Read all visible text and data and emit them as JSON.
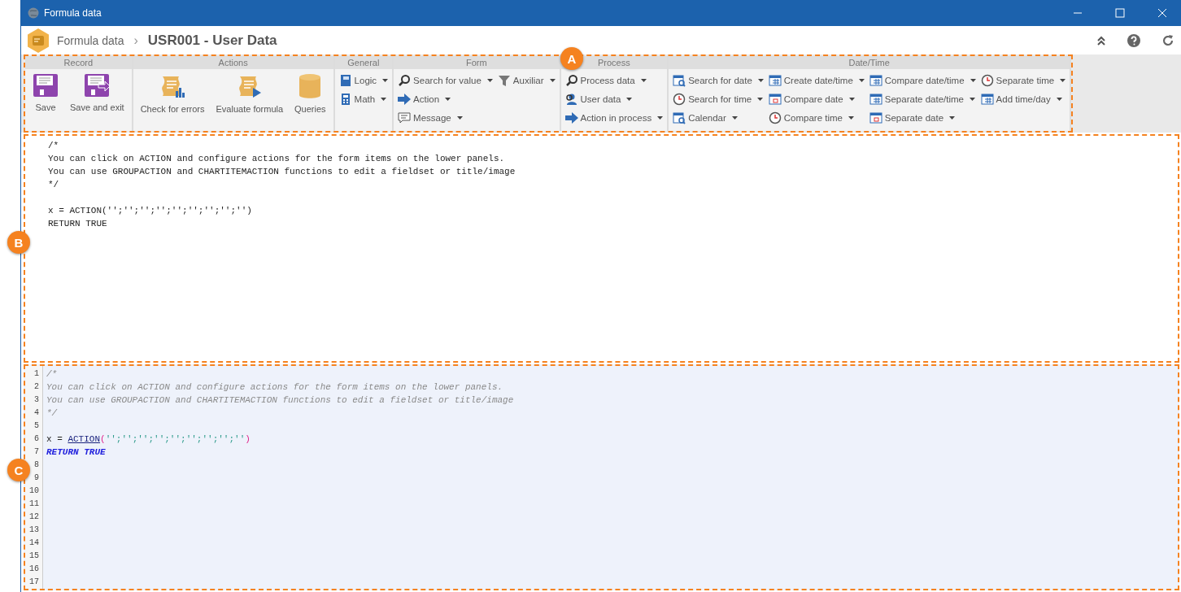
{
  "window": {
    "title": "Formula data"
  },
  "breadcrumb": {
    "parent": "Formula data",
    "separator": "›",
    "current": "USR001 - User Data"
  },
  "ribbon": {
    "badge": "A",
    "groups": [
      {
        "label": "Record",
        "columns": [
          [
            {
              "kind": "large",
              "label": "Save"
            }
          ],
          [
            {
              "kind": "large",
              "label": "Save and exit"
            }
          ]
        ]
      },
      {
        "label": "Actions",
        "columns": [
          [
            {
              "kind": "large",
              "label": "Check for errors"
            }
          ],
          [
            {
              "kind": "large",
              "label": "Evaluate formula"
            }
          ],
          [
            {
              "kind": "large",
              "label": "Queries"
            }
          ]
        ]
      },
      {
        "label": "General",
        "columns": [
          [
            {
              "kind": "small",
              "label": "Logic"
            },
            {
              "kind": "small",
              "label": "Math"
            }
          ]
        ]
      },
      {
        "label": "Form",
        "columns": [
          [
            {
              "kind": "small",
              "label": "Search for value"
            },
            {
              "kind": "small",
              "label": "Action"
            },
            {
              "kind": "small",
              "label": "Message"
            }
          ],
          [
            {
              "kind": "small",
              "label": "Auxiliar"
            }
          ]
        ]
      },
      {
        "label": "Process",
        "columns": [
          [
            {
              "kind": "small",
              "label": "Process data"
            },
            {
              "kind": "small",
              "label": "User data"
            },
            {
              "kind": "small",
              "label": "Action in process"
            }
          ]
        ]
      },
      {
        "label": "Date/Time",
        "columns": [
          [
            {
              "kind": "small",
              "label": "Search for date"
            },
            {
              "kind": "small",
              "label": "Search for time"
            },
            {
              "kind": "small",
              "label": "Calendar"
            }
          ],
          [
            {
              "kind": "small",
              "label": "Create date/time"
            },
            {
              "kind": "small",
              "label": "Compare date"
            },
            {
              "kind": "small",
              "label": "Compare time"
            }
          ],
          [
            {
              "kind": "small",
              "label": "Compare date/time"
            },
            {
              "kind": "small",
              "label": "Separate date/time"
            },
            {
              "kind": "small",
              "label": "Separate date"
            }
          ],
          [
            {
              "kind": "small",
              "label": "Separate time"
            },
            {
              "kind": "small",
              "label": "Add time/day"
            }
          ]
        ]
      }
    ]
  },
  "formula_text": {
    "badge": "B",
    "blocks": [
      [
        "/*",
        "You can click on ACTION and configure actions for the form items on the lower panels.",
        "You can use GROUPACTION and CHARTITEMACTION functions to edit a fieldset or title/image",
        "*/"
      ],
      [
        "x = ACTION('';'';'';'';'';'';'';'';'')",
        "RETURN TRUE"
      ]
    ]
  },
  "code_editor": {
    "badge": "C",
    "lines": [
      {
        "number": "1",
        "tokens": [
          {
            "kind": "comment",
            "text": "/*"
          }
        ]
      },
      {
        "number": "2",
        "tokens": [
          {
            "kind": "comment",
            "text": "You can click on ACTION and configure actions for the form items on the lower panels."
          }
        ]
      },
      {
        "number": "3",
        "tokens": [
          {
            "kind": "comment",
            "text": "You can use GROUPACTION and CHARTITEMACTION functions to edit a fieldset or title/image"
          }
        ]
      },
      {
        "number": "4",
        "tokens": [
          {
            "kind": "comment",
            "text": "*/"
          }
        ]
      },
      {
        "number": "5"
      },
      {
        "number": "6",
        "tokens": [
          {
            "kind": "plain",
            "text": "x = "
          },
          {
            "kind": "function",
            "text": "ACTION"
          },
          {
            "kind": "paren",
            "text": "("
          },
          {
            "kind": "string",
            "text": "'';'';'';'';'';'';'';'';''"
          },
          {
            "kind": "paren",
            "text": ")"
          }
        ]
      },
      {
        "number": "7",
        "tokens": [
          {
            "kind": "keyword",
            "text": "RETURN TRUE"
          }
        ]
      },
      {
        "number": "8"
      },
      {
        "number": "9"
      },
      {
        "number": "10"
      },
      {
        "number": "11"
      },
      {
        "number": "12"
      },
      {
        "number": "13"
      },
      {
        "number": "14"
      },
      {
        "number": "15"
      },
      {
        "number": "16"
      },
      {
        "number": "17"
      }
    ]
  }
}
